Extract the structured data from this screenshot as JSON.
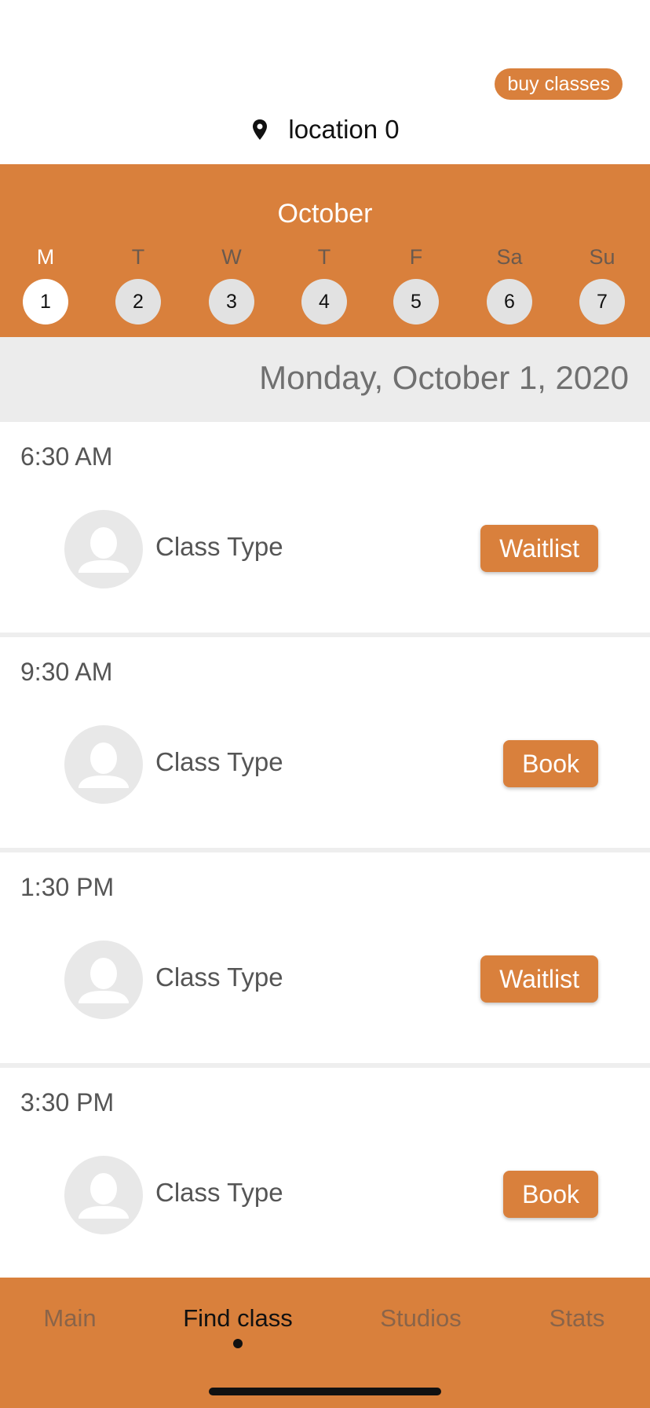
{
  "header": {
    "buy_label": "buy classes",
    "location_label": "location 0"
  },
  "calendar": {
    "month": "October",
    "days": [
      {
        "letter": "M",
        "number": "1",
        "selected": true
      },
      {
        "letter": "T",
        "number": "2",
        "selected": false
      },
      {
        "letter": "W",
        "number": "3",
        "selected": false
      },
      {
        "letter": "T",
        "number": "4",
        "selected": false
      },
      {
        "letter": "F",
        "number": "5",
        "selected": false
      },
      {
        "letter": "Sa",
        "number": "6",
        "selected": false
      },
      {
        "letter": "Su",
        "number": "7",
        "selected": false
      }
    ]
  },
  "selected_date": "Monday, October 1, 2020",
  "classes": [
    {
      "time": "6:30 AM",
      "type": "Class Type",
      "action": "Waitlist"
    },
    {
      "time": "9:30 AM",
      "type": "Class Type",
      "action": "Book"
    },
    {
      "time": "1:30 PM",
      "type": "Class Type",
      "action": "Waitlist"
    },
    {
      "time": "3:30 PM",
      "type": "Class Type",
      "action": "Book"
    }
  ],
  "nav": {
    "items": [
      {
        "label": "Main",
        "active": false
      },
      {
        "label": "Find class",
        "active": true
      },
      {
        "label": "Studios",
        "active": false
      },
      {
        "label": "Stats",
        "active": false
      }
    ]
  },
  "colors": {
    "accent": "#d9803c",
    "date_bar": "#ececec",
    "inactive_day": "#e2e2e2"
  }
}
